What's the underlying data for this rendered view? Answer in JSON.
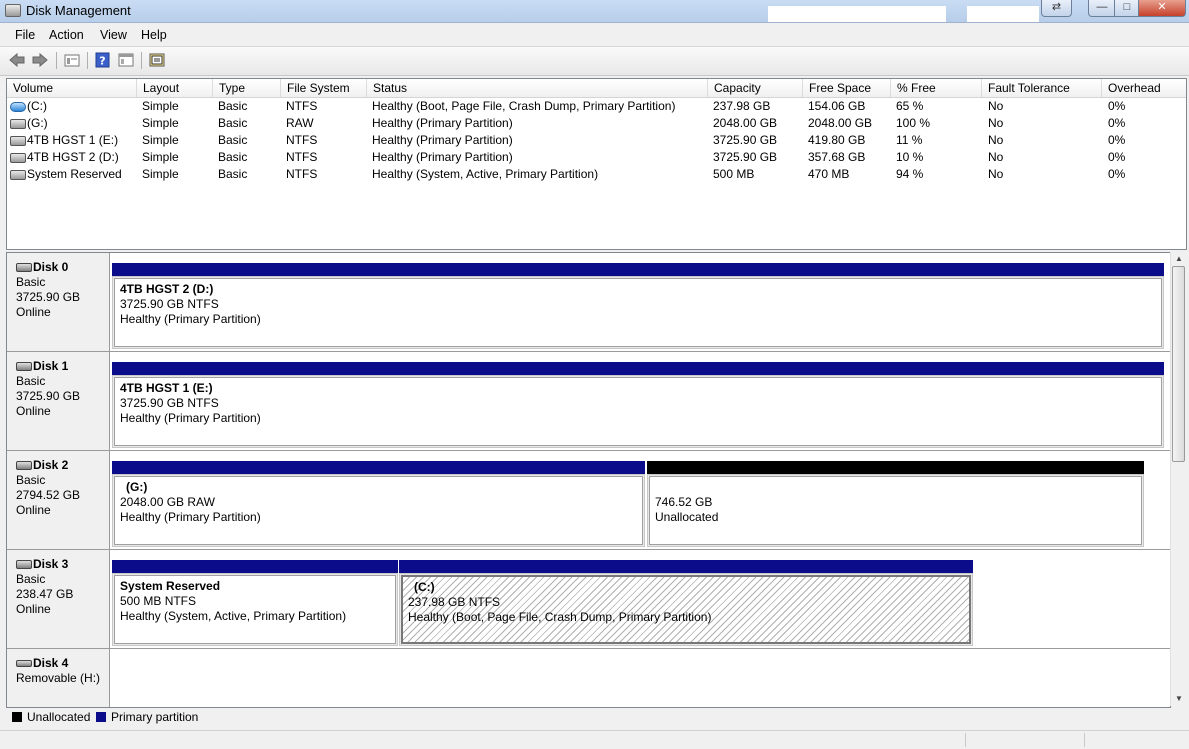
{
  "window": {
    "title": "Disk Management",
    "controls": {
      "minimize": "—",
      "maximize": "□",
      "close": "✕"
    }
  },
  "menu": [
    "File",
    "Action",
    "View",
    "Help"
  ],
  "toolbar": [
    "back-icon",
    "forward-icon",
    "properties-icon",
    "help-icon",
    "console-icon",
    "refresh-icon"
  ],
  "volume_list": {
    "headers": [
      "Volume",
      "Layout",
      "Type",
      "File System",
      "Status",
      "Capacity",
      "Free Space",
      "% Free",
      "Fault Tolerance",
      "Overhead"
    ],
    "rows": [
      [
        "(C:)",
        "Simple",
        "Basic",
        "NTFS",
        "Healthy (Boot, Page File, Crash Dump, Primary Partition)",
        "237.98 GB",
        "154.06 GB",
        "65 %",
        "No",
        "0%"
      ],
      [
        "(G:)",
        "Simple",
        "Basic",
        "RAW",
        "Healthy (Primary Partition)",
        "2048.00 GB",
        "2048.00 GB",
        "100 %",
        "No",
        "0%"
      ],
      [
        "4TB HGST 1 (E:)",
        "Simple",
        "Basic",
        "NTFS",
        "Healthy (Primary Partition)",
        "3725.90 GB",
        "419.80 GB",
        "11 %",
        "No",
        "0%"
      ],
      [
        "4TB HGST 2 (D:)",
        "Simple",
        "Basic",
        "NTFS",
        "Healthy (Primary Partition)",
        "3725.90 GB",
        "357.68 GB",
        "10 %",
        "No",
        "0%"
      ],
      [
        "System Reserved",
        "Simple",
        "Basic",
        "NTFS",
        "Healthy (System, Active, Primary Partition)",
        "500 MB",
        "470 MB",
        "94 %",
        "No",
        "0%"
      ]
    ]
  },
  "disks": [
    {
      "name": "Disk 0",
      "type": "Basic",
      "size": "3725.90 GB",
      "status": "Online",
      "partitions": [
        {
          "name": "4TB HGST 2  (D:)",
          "size_fs": "3725.90 GB NTFS",
          "status": "Healthy (Primary Partition)"
        }
      ]
    },
    {
      "name": "Disk 1",
      "type": "Basic",
      "size": "3725.90 GB",
      "status": "Online",
      "partitions": [
        {
          "name": "4TB HGST 1  (E:)",
          "size_fs": "3725.90 GB NTFS",
          "status": "Healthy (Primary Partition)"
        }
      ]
    },
    {
      "name": "Disk 2",
      "type": "Basic",
      "size": "2794.52 GB",
      "status": "Online",
      "partitions": [
        {
          "name": "(G:)",
          "size_fs": "2048.00 GB RAW",
          "status": "Healthy (Primary Partition)"
        },
        {
          "name": "",
          "size_fs": "746.52 GB",
          "status": "Unallocated"
        }
      ]
    },
    {
      "name": "Disk 3",
      "type": "Basic",
      "size": "238.47 GB",
      "status": "Online",
      "partitions": [
        {
          "name": "System Reserved",
          "size_fs": "500 MB NTFS",
          "status": "Healthy (System, Active, Primary Partition)"
        },
        {
          "name": "(C:)",
          "size_fs": "237.98 GB NTFS",
          "status": "Healthy (Boot, Page File, Crash Dump, Primary Partition)"
        }
      ]
    },
    {
      "name": "Disk 4",
      "type": "Removable (H:)"
    }
  ],
  "legend": [
    {
      "label": "Unallocated",
      "color": "#000000"
    },
    {
      "label": "Primary partition",
      "color": "#0a0c8a"
    }
  ]
}
